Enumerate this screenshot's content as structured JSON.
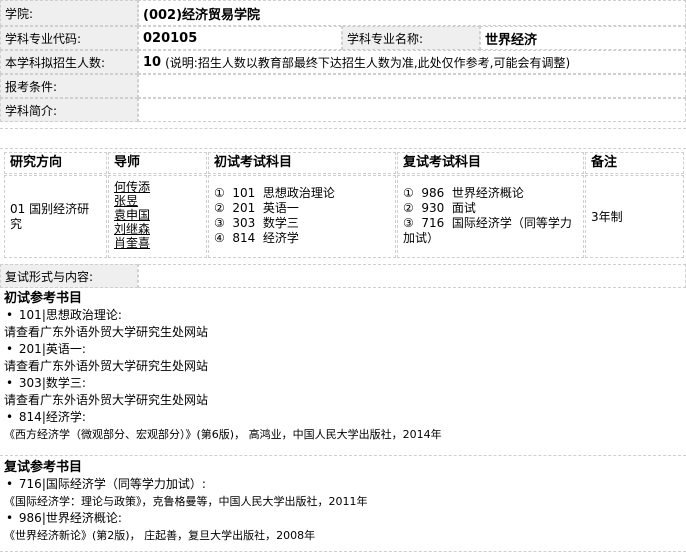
{
  "info": {
    "college_label": "学院:",
    "college_value": "(002)经济贸易学院",
    "code_label": "学科专业代码:",
    "code_value": "020105",
    "name_label": "学科专业名称:",
    "name_value": "世界经济",
    "enroll_label": "本学科拟招生人数:",
    "enroll_value": "10",
    "enroll_note": "(说明:招生人数以教育部最终下达招生人数为准,此处仅作参考,可能会有调整)",
    "condition_label": "报考条件:",
    "condition_value": "",
    "intro_label": "学科简介:",
    "intro_value": ""
  },
  "exam_table": {
    "headers": [
      "研究方向",
      "导师",
      "初试考试科目",
      "复试考试科目",
      "备注"
    ],
    "direction": "01 国别经济研究",
    "teachers": [
      "何传添",
      "张昱",
      "袁申国",
      "刘继森",
      "肖奎喜"
    ],
    "initial_subjects": [
      "①  101  思想政治理论",
      "②  201  英语一",
      "③  303  数学三",
      "④  814  经济学"
    ],
    "retest_subjects": [
      "①  986  世界经济概论",
      "②  930  面试",
      "③  716  国际经济学（同等学力",
      "加试）"
    ],
    "remark": "3年制"
  },
  "retest_form": {
    "label": "复试形式与内容:",
    "value": ""
  },
  "initial_books": {
    "title": "初试参考书目",
    "items": [
      {
        "bullet": "•",
        "code": "101",
        "subject": "思想政治理论:",
        "desc": "请查看广东外语外贸大学研究生处网站"
      },
      {
        "bullet": "•",
        "code": "201",
        "subject": "英语一:",
        "desc": "请查看广东外语外贸大学研究生处网站"
      },
      {
        "bullet": "•",
        "code": "303",
        "subject": "数学三:",
        "desc": "请查看广东外语外贸大学研究生处网站"
      },
      {
        "bullet": "•",
        "code": "814",
        "subject": "经济学:",
        "desc": "《西方经济学（微观部分、宏观部分）》(第6版)， 高鸿业，中国人民大学出版社，2014年"
      }
    ]
  },
  "retest_books": {
    "title": "复试参考书目",
    "items": [
      {
        "bullet": "•",
        "code": "716",
        "subject": "国际经济学（同等学力加试）:",
        "desc": "《国际经济学：理论与政策》，克鲁格曼等，中国人民大学出版社，2011年"
      },
      {
        "bullet": "•",
        "code": "986",
        "subject": "世界经济概论:",
        "desc": "《世界经济新论》(第2版)， 庄起善，复旦大学出版社，2008年"
      }
    ]
  }
}
